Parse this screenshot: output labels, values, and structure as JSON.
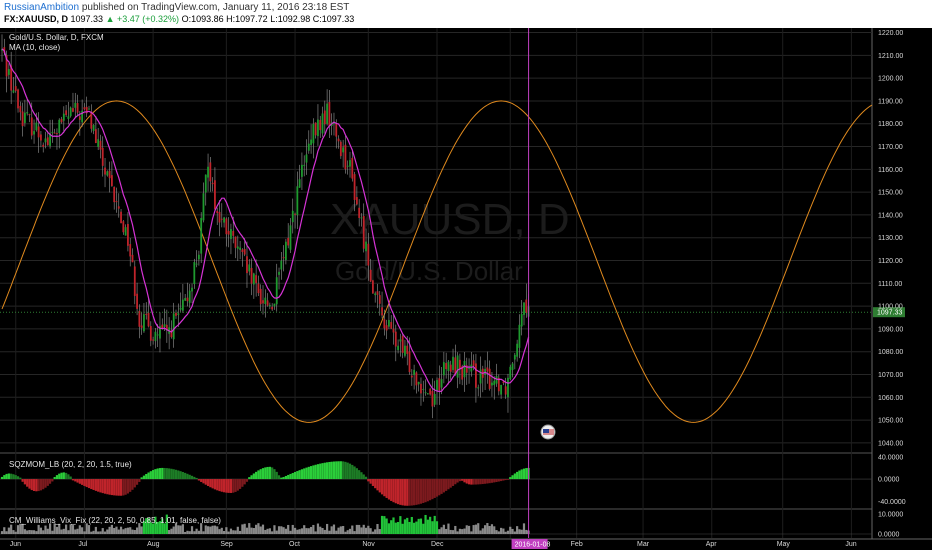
{
  "header": {
    "author": "RussianAmbition",
    "published": " published on TradingView.com, January 11, 2016 23:18 EST",
    "symbol": "FX:XAUUSD, D",
    "last": "1097.33",
    "change": "▲ +3.47 (+0.32%)",
    "open": "O:1093.86",
    "high": "H:1097.72",
    "low": "L:1092.98",
    "close": "C:1097.33"
  },
  "watermark": {
    "symbol": "XAUUSD, D",
    "name": "Gold/U.S. Dollar"
  },
  "colors": {
    "up": "#1f9a2f",
    "down": "#c0242b",
    "ma": "#d633d6",
    "sine": "#e08a1e",
    "cursor": "#c040c0",
    "price_line": "#2e7d32"
  },
  "chart_data": [
    {
      "type": "candlestick",
      "title": "Gold/U.S. Dollar, D, FXCM",
      "indicator": "MA (10, close)",
      "last_price": "1097.33",
      "cursor_date": "2016-01-08",
      "ylim": [
        1036,
        1222
      ],
      "y_ticks": [
        1040,
        1050,
        1060,
        1070,
        1080,
        1090,
        1100,
        1110,
        1120,
        1130,
        1140,
        1150,
        1160,
        1170,
        1180,
        1190,
        1200,
        1210,
        1220
      ],
      "x_ticks": [
        "Jun",
        "Jul",
        "Aug",
        "Sep",
        "Oct",
        "Nov",
        "Dec",
        "2016-01-08",
        "Feb",
        "Mar",
        "Apr",
        "May",
        "Jun"
      ],
      "close_path": [
        [
          0,
          1212
        ],
        [
          8,
          1185
        ],
        [
          20,
          1172
        ],
        [
          30,
          1185
        ],
        [
          38,
          1184
        ],
        [
          46,
          1155
        ],
        [
          55,
          1130
        ],
        [
          60,
          1095
        ],
        [
          66,
          1088
        ],
        [
          72,
          1088
        ],
        [
          80,
          1100
        ],
        [
          86,
          1125
        ],
        [
          90,
          1165
        ],
        [
          94,
          1140
        ],
        [
          100,
          1130
        ],
        [
          106,
          1118
        ],
        [
          112,
          1105
        ],
        [
          118,
          1100
        ],
        [
          124,
          1125
        ],
        [
          130,
          1155
        ],
        [
          136,
          1175
        ],
        [
          142,
          1185
        ],
        [
          148,
          1170
        ],
        [
          152,
          1160
        ],
        [
          158,
          1130
        ],
        [
          164,
          1100
        ],
        [
          170,
          1088
        ],
        [
          176,
          1078
        ],
        [
          182,
          1068
        ],
        [
          188,
          1060
        ],
        [
          192,
          1070
        ],
        [
          198,
          1075
        ],
        [
          204,
          1070
        ],
        [
          210,
          1068
        ],
        [
          216,
          1068
        ],
        [
          220,
          1065
        ],
        [
          224,
          1082
        ],
        [
          228,
          1105
        ],
        [
          230,
          1097.33
        ]
      ],
      "sine": {
        "center": 1119.5,
        "amplitude": 70.5,
        "period_days": 168,
        "peak_day": 50
      }
    },
    {
      "type": "bar",
      "title": "SQZMOM_LB (20, 2, 20, 1.5, true)",
      "ylim": [
        -52,
        45
      ],
      "y_ticks": [
        "40.0000",
        "0.0000",
        "-40.0000"
      ],
      "segments": [
        {
          "start": 0,
          "end": 8,
          "peak": 10,
          "apex": 3
        },
        {
          "start": 9,
          "end": 22,
          "peak": -22,
          "apex": 15
        },
        {
          "start": 23,
          "end": 30,
          "peak": 12,
          "apex": 27
        },
        {
          "start": 31,
          "end": 60,
          "peak": -30,
          "apex": 52
        },
        {
          "start": 61,
          "end": 85,
          "peak": 20,
          "apex": 70
        },
        {
          "start": 86,
          "end": 107,
          "peak": -25,
          "apex": 100
        },
        {
          "start": 108,
          "end": 121,
          "peak": 22,
          "apex": 117
        },
        {
          "start": 122,
          "end": 159,
          "peak": 32,
          "apex": 148
        },
        {
          "start": 160,
          "end": 200,
          "peak": -48,
          "apex": 177
        },
        {
          "start": 201,
          "end": 221,
          "peak": -10,
          "apex": 205
        },
        {
          "start": 222,
          "end": 230,
          "peak": 20,
          "apex": 230
        }
      ]
    },
    {
      "type": "bar",
      "title": "CM_Williams_Vix_Fix (22, 20, 2, 50, 0.85, 1.01, false, false)",
      "ylim": [
        -2,
        12
      ],
      "y_ticks": [
        "10.0000",
        "0.0000"
      ],
      "highlight_ranges": [
        [
          62,
          72
        ],
        [
          166,
          190
        ]
      ]
    }
  ]
}
